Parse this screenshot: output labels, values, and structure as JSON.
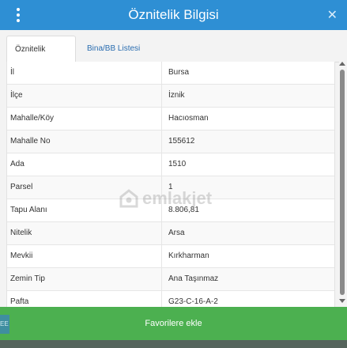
{
  "titlebar": {
    "title": "Öznitelik Bilgisi",
    "menu_icon": "vertical-dots-icon",
    "close_label": "✕"
  },
  "tabs": [
    {
      "label": "Öznitelik Bilgisi",
      "active": true
    },
    {
      "label": "Bina/BB Listesi",
      "active": false
    }
  ],
  "attributes": [
    {
      "label": "İl",
      "value": "Bursa"
    },
    {
      "label": "İlçe",
      "value": "İznik"
    },
    {
      "label": "Mahalle/Köy",
      "value": "Hacıosman"
    },
    {
      "label": "Mahalle No",
      "value": "155612"
    },
    {
      "label": "Ada",
      "value": "1510"
    },
    {
      "label": "Parsel",
      "value": "1"
    },
    {
      "label": "Tapu Alanı",
      "value": "8.806,81"
    },
    {
      "label": "Nitelik",
      "value": "Arsa"
    },
    {
      "label": "Mevkii",
      "value": "Kırkharman"
    },
    {
      "label": "Zemin Tip",
      "value": "Ana Taşınmaz"
    },
    {
      "label": "Pafta",
      "value": "G23-C-16-A-2"
    }
  ],
  "watermark": {
    "text": "emlakjet",
    "icon": "emlakjet-logo-icon"
  },
  "footer": {
    "button_label": "Favorilere ekle"
  },
  "side_tab": {
    "label": "EE"
  },
  "colors": {
    "titlebar": "#2e8fd4",
    "footer_button": "#4cb050",
    "tab_link": "#2a6db0"
  }
}
